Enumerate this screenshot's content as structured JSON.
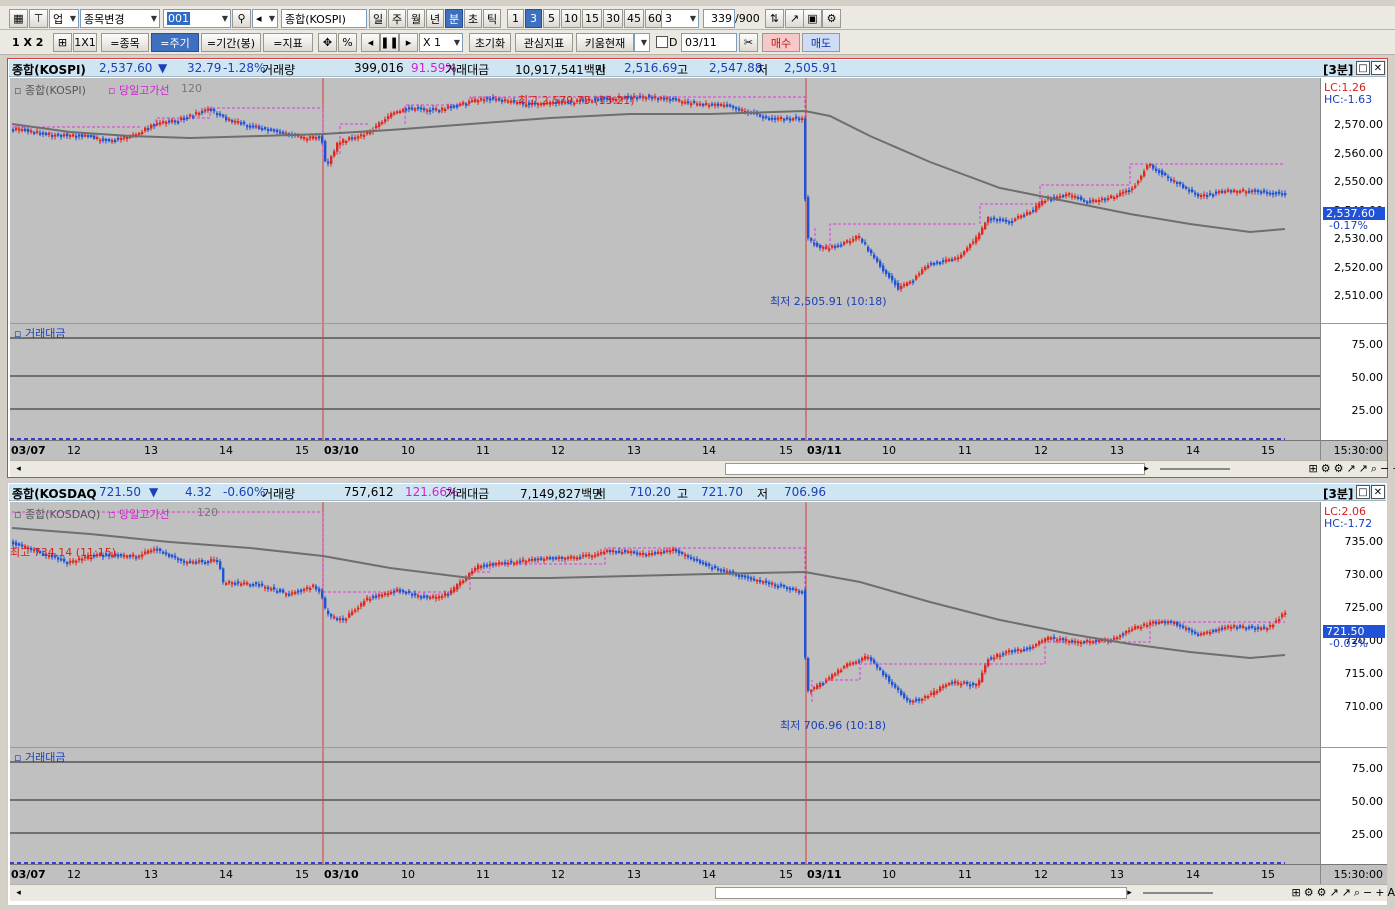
{
  "toolbar1": {
    "stock_change": "종목변경",
    "code": "001",
    "name": "종합(KOSPI)",
    "periods": [
      "일",
      "주",
      "월",
      "년",
      "분",
      "초",
      "틱"
    ],
    "minutes": [
      "1",
      "3",
      "5",
      "10",
      "15",
      "30",
      "45",
      "60"
    ],
    "sel_min": "3",
    "count": "339",
    "count_max": "/900",
    "ud": "업"
  },
  "toolbar2": {
    "layout": "1 X 2",
    "one": "1X1",
    "b_stock": "=종목",
    "b_cycle": "=주기",
    "b_period": "=기간(봉)",
    "b_ind": "=지표",
    "pct": "%",
    "mult": "X 1",
    "reset": "초기화",
    "interest": "관심지표",
    "kiwoom": "키움현재",
    "d": "D",
    "date": "03/11",
    "buy": "매수",
    "sell": "매도"
  },
  "kospi": {
    "name": "종합(KOSPI)",
    "price": "2,537.60",
    "arrow": "▼",
    "change": "32.79",
    "rate": "-1.28%",
    "vol_label": "거래량",
    "volume": "399,016",
    "vol_rate": "91.59%",
    "amt_label": "거래대금",
    "amount": "10,917,541백만",
    "open_label": "시",
    "open": "2,516.69",
    "high_label": "고",
    "high": "2,547.88",
    "low_label": "저",
    "low": "2,505.91",
    "interval": "[3분]",
    "legend_name": "종합(KOSPI)",
    "legend_line": "당일고가선",
    "legend_ma": "120",
    "high_note": "최고 2,579.75 (13:21)",
    "low_note": "최저 2,505.91 (10:18)",
    "lc": "LC:1.26",
    "hc": "HC:-1.63",
    "cur_tag": "2,537.60",
    "cur_pct": "-0.17%",
    "yticks": [
      "2,570.00",
      "2,560.00",
      "2,550.00",
      "2,540.00",
      "2,530.00",
      "2,520.00",
      "2,510.00"
    ],
    "sub_title": "거래대금",
    "sub_ticks": [
      "75.00",
      "50.00",
      "25.00"
    ],
    "xlabels": [
      "03/07",
      "12",
      "13",
      "14",
      "15",
      "03/10",
      "10",
      "11",
      "12",
      "13",
      "14",
      "15",
      "03/11",
      "10",
      "11",
      "12",
      "13",
      "14",
      "15"
    ],
    "time": "15:30:00"
  },
  "kosdaq": {
    "name": "종합(KOSDAQ",
    "price": "721.50",
    "arrow": "▼",
    "change": "4.32",
    "rate": "-0.60%",
    "vol_label": "거래량",
    "volume": "757,612",
    "vol_rate": "121.66%",
    "amt_label": "거래대금",
    "amount": "7,149,827백만",
    "open_label": "시",
    "open": "710.20",
    "high_label": "고",
    "high": "721.70",
    "low_label": "저",
    "low": "706.96",
    "interval": "[3분]",
    "legend_name": "종합(KOSDAQ)",
    "legend_line": "당일고가선",
    "legend_ma": "120",
    "high_note": "최고 734.14 (11:15)",
    "low_note": "최저 706.96 (10:18)",
    "lc": "LC:2.06",
    "hc": "HC:-1.72",
    "cur_tag": "721.50",
    "cur_pct": "-0.03%",
    "yticks": [
      "735.00",
      "730.00",
      "725.00",
      "720.00",
      "715.00",
      "710.00"
    ],
    "sub_title": "거래대금",
    "sub_ticks": [
      "75.00",
      "50.00",
      "25.00"
    ],
    "xlabels": [
      "03/07",
      "12",
      "13",
      "14",
      "15",
      "03/10",
      "10",
      "11",
      "12",
      "13",
      "14",
      "15",
      "03/11",
      "10",
      "11",
      "12",
      "13",
      "14",
      "15"
    ],
    "time": "15:30:00"
  },
  "colors": {
    "up": "#e0261d",
    "down": "#1f52d6",
    "ma": "#6e6e6e",
    "highline": "#e03ae0",
    "bg": "#c0c0c0"
  }
}
